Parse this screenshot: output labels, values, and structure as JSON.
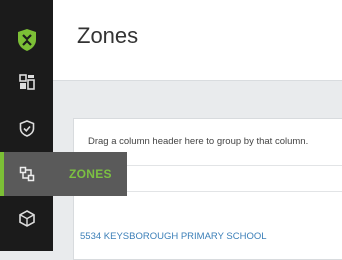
{
  "page": {
    "title": "Zones"
  },
  "sidebar": {
    "items": [
      {
        "name": "logo",
        "icon": "shield-logo-icon"
      },
      {
        "name": "dashboard",
        "icon": "dashboard-icon"
      },
      {
        "name": "shield",
        "icon": "shield-check-icon"
      },
      {
        "name": "zones",
        "icon": "zones-network-icon",
        "label": "ZONES",
        "active": true
      },
      {
        "name": "devices",
        "icon": "cube-icon"
      }
    ],
    "accent_color": "#7cbf36"
  },
  "grid": {
    "group_hint": "Drag a column header here to group by that column.",
    "rows": [
      {
        "name": "5534 KEYSBOROUGH PRIMARY SCHOOL"
      }
    ]
  }
}
